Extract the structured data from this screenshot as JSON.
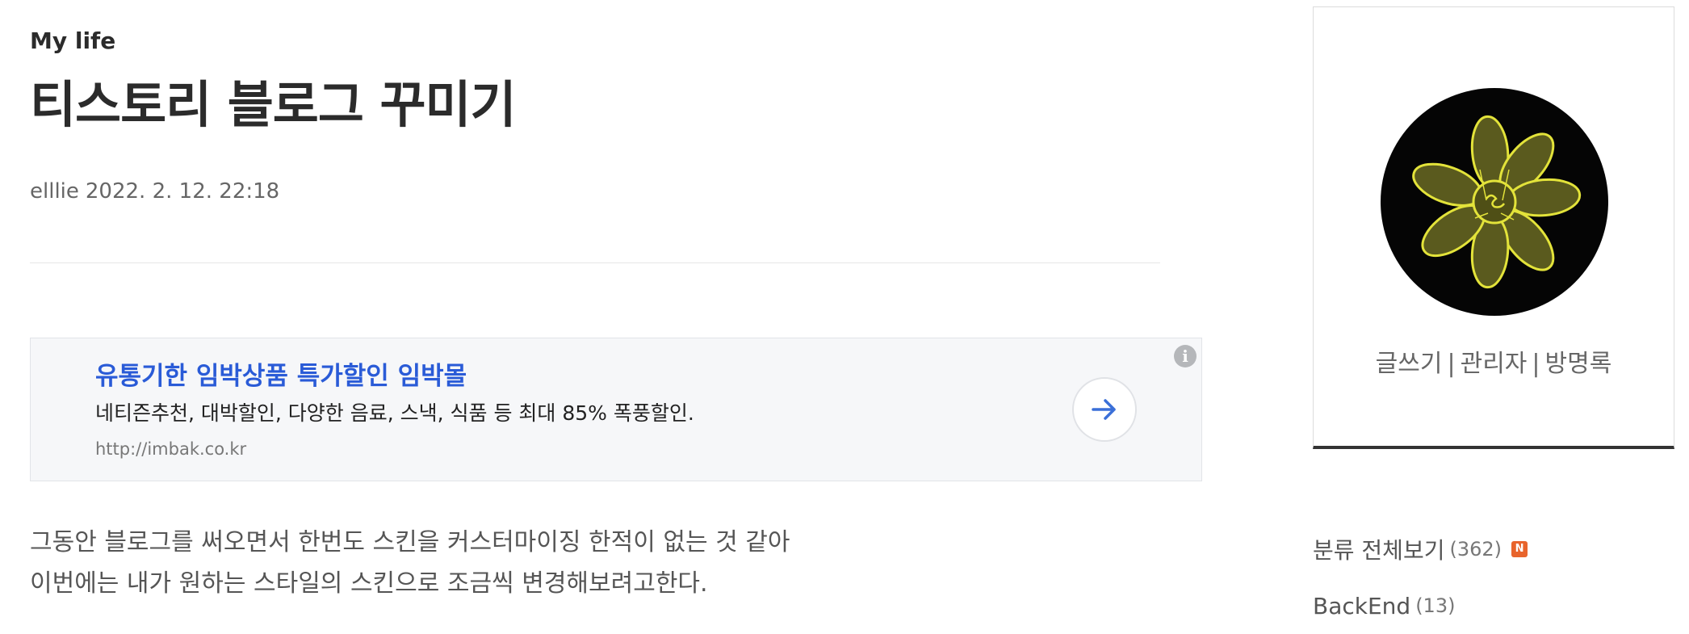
{
  "post": {
    "category": "My life",
    "title": "티스토리 블로그 꾸미기",
    "author": "elllie",
    "date": "2022. 2. 12. 22:18",
    "body_lines": [
      "그동안 블로그를 써오면서 한번도 스킨을 커스터마이징 한적이 없는 것 같아",
      "이번에는 내가 원하는 스타일의 스킨으로 조금씩 변경해보려고한다."
    ]
  },
  "ad": {
    "title": "유통기한 임박상품 특가할인 임박몰",
    "description": "네티즌추천, 대박할인, 다양한 음료, 스낵, 식품 등 최대 85% 폭풍할인.",
    "url": "http://imbak.co.kr",
    "info_icon": "info-icon",
    "arrow_icon": "arrow-right-icon",
    "accent_color": "#2a5bd7"
  },
  "sidebar": {
    "profile_links": [
      "글쓰기",
      "관리자",
      "방명록"
    ],
    "link_separator": "|",
    "categories": [
      {
        "label": "분류 전체보기",
        "count": "(362)",
        "badge": "N"
      },
      {
        "label": "BackEnd",
        "count": "(13)"
      }
    ],
    "badge_color": "#e8642c"
  }
}
